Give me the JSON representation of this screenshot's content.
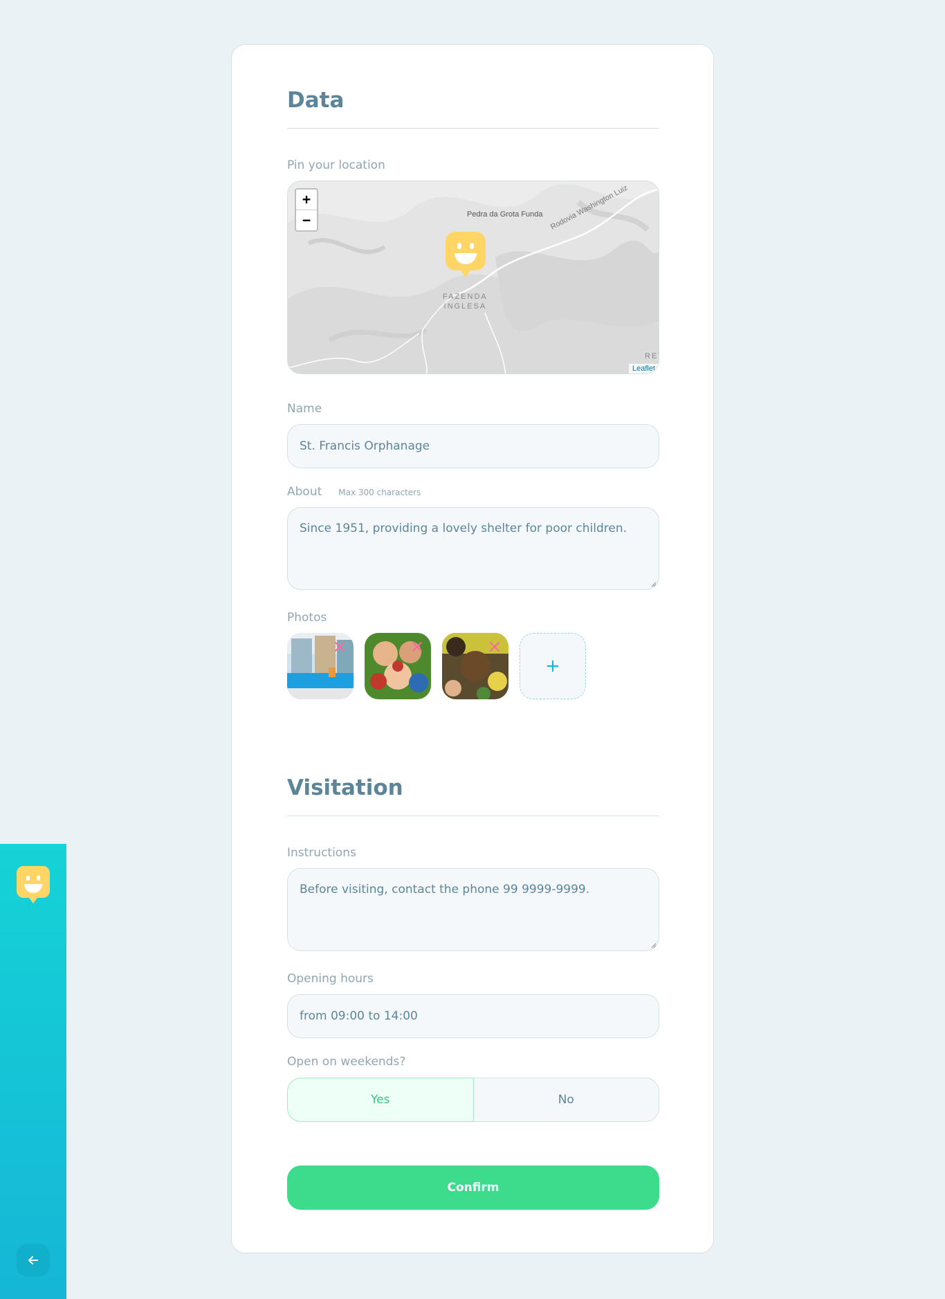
{
  "sections": {
    "data_title": "Data",
    "visitation_title": "Visitation"
  },
  "map": {
    "label": "Pin your location",
    "zoom_in": "+",
    "zoom_out": "−",
    "place_label": "Pedra da Grota Funda",
    "road_label": "Rodovia Washington Luiz",
    "area_label_line1": "FAZENDA",
    "area_label_line2": "INGLESA",
    "edge_label": "RET",
    "attribution": "Leaflet"
  },
  "name": {
    "label": "Name",
    "value": "St. Francis Orphanage"
  },
  "about": {
    "label": "About",
    "hint": "Max 300 characters",
    "value": "Since 1951, providing a lovely shelter for poor children."
  },
  "photos": {
    "label": "Photos",
    "add": "+"
  },
  "instructions": {
    "label": "Instructions",
    "value": "Before visiting, contact the phone 99 9999-9999."
  },
  "opening_hours": {
    "label": "Opening hours",
    "value": "from 09:00 to 14:00"
  },
  "weekends": {
    "label": "Open on weekends?",
    "yes": "Yes",
    "no": "No",
    "selected": "Yes"
  },
  "confirm": "Confirm",
  "colors": {
    "sidebar_top": "#15d3d6",
    "sidebar_bottom": "#15b6d6",
    "marker": "#ffd666",
    "confirm": "#3cdc8c",
    "title": "#5c8599",
    "label": "#8fa7b3"
  }
}
